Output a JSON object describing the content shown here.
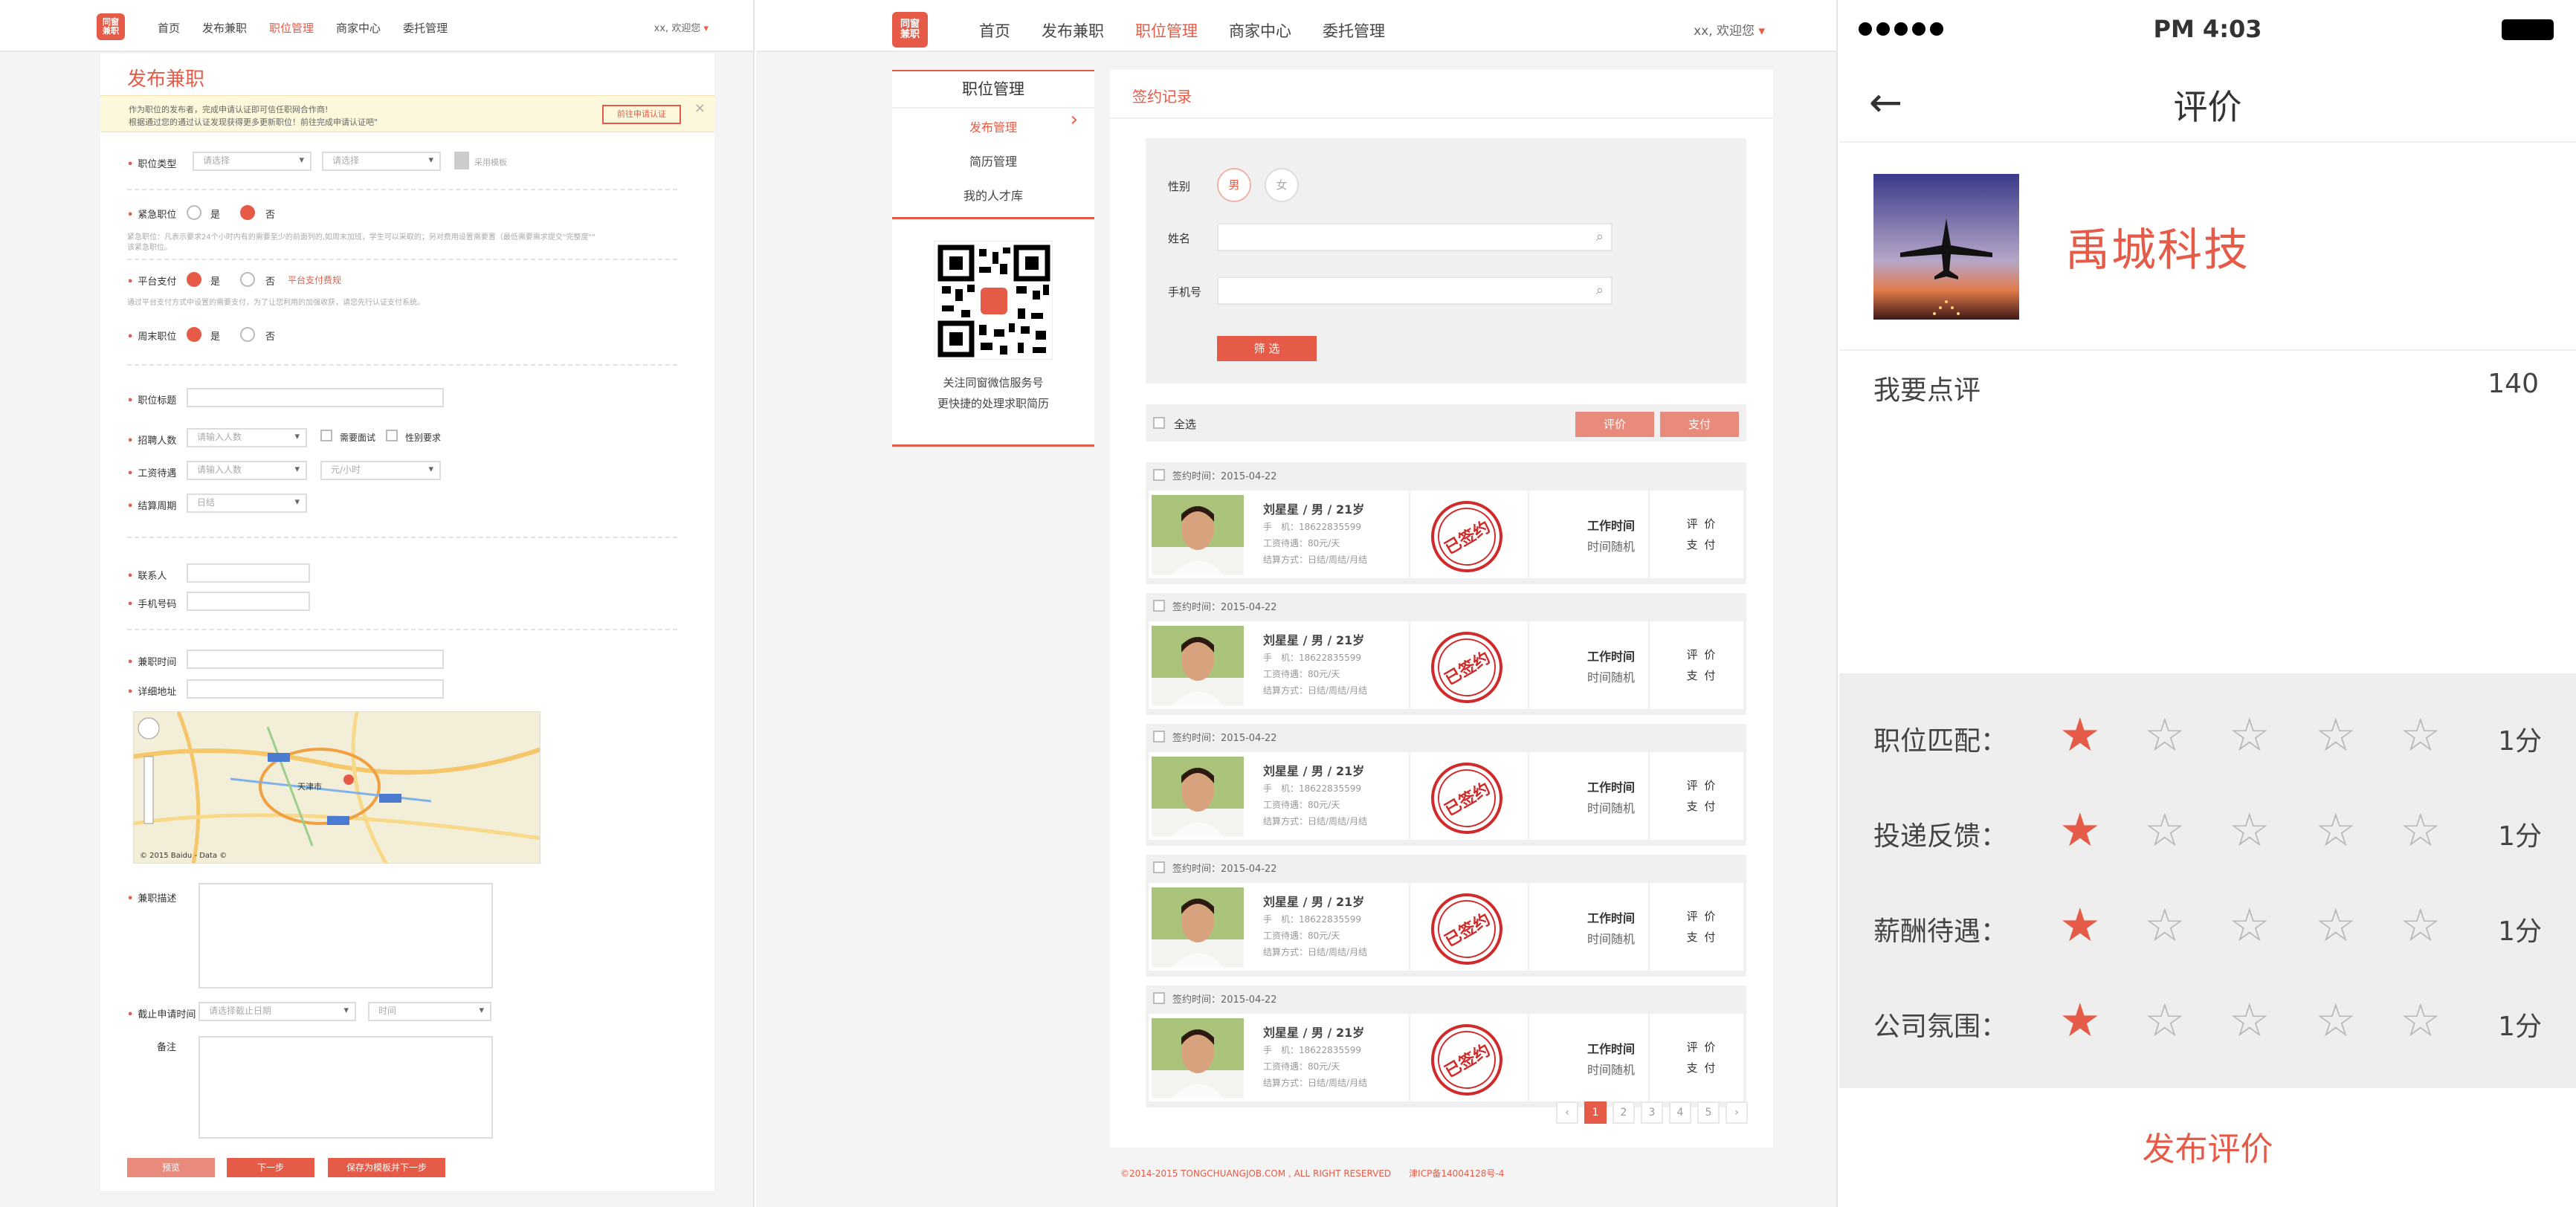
{
  "panel1": {
    "logo": "同窗\n兼职",
    "nav": [
      "首页",
      "发布兼职",
      "职位管理",
      "商家中心",
      "委托管理"
    ],
    "welcome": "xx, 欢迎您",
    "title": "发布兼职",
    "notice_line1": "作为职位的发布者，完成申请认证即可信任职网合作商!",
    "notice_line2": "根据通过您的通过认证发现获得更多更新职位！前往完成申请认证吧\"",
    "notice_button": "前往申请认证",
    "job_type_label": "职位类型",
    "job_type_placeholders": [
      "请选择",
      "请选择"
    ],
    "use_template": "采用模板",
    "urgent_label": "紧急职位",
    "yes": "是",
    "no": "否",
    "urgent_hint": "紧急职位：凡表示要求24个小时内有的需要至少的前面列的,如周末加班，学生可以采取的；另对费用设置需要置（最低需要需求提交\"完整度\"\"",
    "urgent_hint2": "该紧急职位。",
    "platform_label": "平台支付",
    "platform_link": "平台支付费规",
    "platform_hint": "通过平台支付方式中设置的需要支付，为了让您利用的加强收获，请您先行认证支付系统。",
    "weekend_label": "周末职位",
    "title_label": "职位标题",
    "headcount_label": "招聘人数",
    "headcount_placeholder": "请输入人数",
    "need_interview": "需要面试",
    "gender_req": "性别要求",
    "salary_label": "工资待遇",
    "salary_placeholder": "请输入人数",
    "salary_unit": "元/小时",
    "settle_label": "结算周期",
    "settle_value": "日结",
    "contact_label": "联系人",
    "phone_label": "手机号码",
    "worktime_label": "兼职时间",
    "address_label": "详细地址",
    "map_city": "天津市",
    "map_credit": "© 2015 Baidu - Data ©",
    "desc_label": "兼职描述",
    "deadline_label": "截止申请时间",
    "deadline_placeholders": [
      "请选择截止日期",
      "时间"
    ],
    "remark_label": "备注",
    "buttons": [
      "预览",
      "下一步",
      "保存为模板并下一步"
    ]
  },
  "panel2": {
    "logo": "同窗\n兼职",
    "nav": [
      "首页",
      "发布兼职",
      "职位管理",
      "商家中心",
      "委托管理"
    ],
    "welcome": "xx, 欢迎您",
    "side_title": "职位管理",
    "side_items": [
      "发布管理",
      "简历管理",
      "我的人才库"
    ],
    "qr_caption1": "关注同窗微信服务号",
    "qr_caption2": "更快捷的处理求职简历",
    "main_title": "签约记录",
    "gender_label": "性别",
    "gender_options": [
      "男",
      "女"
    ],
    "name_label": "姓名",
    "mobile_label": "手机号",
    "filter_button": "筛 选",
    "select_all": "全选",
    "btn_review": "评价",
    "btn_pay": "支付",
    "records": [
      {
        "date": "签约时间：2015-04-22",
        "name": "刘星星 / 男 / 21岁",
        "mobile": "手　机：18622835599",
        "wage": "工资待遇：80元/天",
        "settle": "结算方式：日结/周结/月结",
        "stamp": "已签约",
        "worktime": "工作时间",
        "worktime_val": "时间随机",
        "act1": "评 价",
        "act2": "支 付"
      },
      {
        "date": "签约时间：2015-04-22",
        "name": "刘星星 / 男 / 21岁",
        "mobile": "手　机：18622835599",
        "wage": "工资待遇：80元/天",
        "settle": "结算方式：日结/周结/月结",
        "stamp": "已签约",
        "worktime": "工作时间",
        "worktime_val": "时间随机",
        "act1": "评 价",
        "act2": "支 付"
      },
      {
        "date": "签约时间：2015-04-22",
        "name": "刘星星 / 男 / 21岁",
        "mobile": "手　机：18622835599",
        "wage": "工资待遇：80元/天",
        "settle": "结算方式：日结/周结/月结",
        "stamp": "已签约",
        "worktime": "工作时间",
        "worktime_val": "时间随机",
        "act1": "评 价",
        "act2": "支 付"
      },
      {
        "date": "签约时间：2015-04-22",
        "name": "刘星星 / 男 / 21岁",
        "mobile": "手　机：18622835599",
        "wage": "工资待遇：80元/天",
        "settle": "结算方式：日结/周结/月结",
        "stamp": "已签约",
        "worktime": "工作时间",
        "worktime_val": "时间随机",
        "act1": "评 价",
        "act2": "支 付"
      },
      {
        "date": "签约时间：2015-04-22",
        "name": "刘星星 / 男 / 21岁",
        "mobile": "手　机：18622835599",
        "wage": "工资待遇：80元/天",
        "settle": "结算方式：日结/周结/月结",
        "stamp": "已签约",
        "worktime": "工作时间",
        "worktime_val": "时间随机",
        "act1": "评 价",
        "act2": "支 付"
      }
    ],
    "pager": [
      "‹",
      "1",
      "2",
      "3",
      "4",
      "5",
      "›"
    ],
    "footer": "©2014-2015 TONGCHUANGJOB.COM , ALL RIGHT RESERVED　　津ICP备14004128号-4"
  },
  "panel3": {
    "time": "PM 4:03",
    "title": "评价",
    "company": "禹城科技",
    "my_review": "我要点评",
    "count": "140",
    "ratings": [
      {
        "label": "职位匹配：",
        "stars": 1,
        "score": "1分"
      },
      {
        "label": "投递反馈：",
        "stars": 1,
        "score": "1分"
      },
      {
        "label": "薪酬待遇：",
        "stars": 1,
        "score": "1分"
      },
      {
        "label": "公司氛围：",
        "stars": 1,
        "score": "1分"
      }
    ],
    "publish": "发布评价"
  },
  "colors": {
    "accent": "#e55b47",
    "stamp": "#d02a2a"
  },
  "icons": [
    "back-arrow-icon",
    "search-icon",
    "star-icon",
    "chevron-right-icon",
    "qr-code-icon",
    "close-icon"
  ]
}
